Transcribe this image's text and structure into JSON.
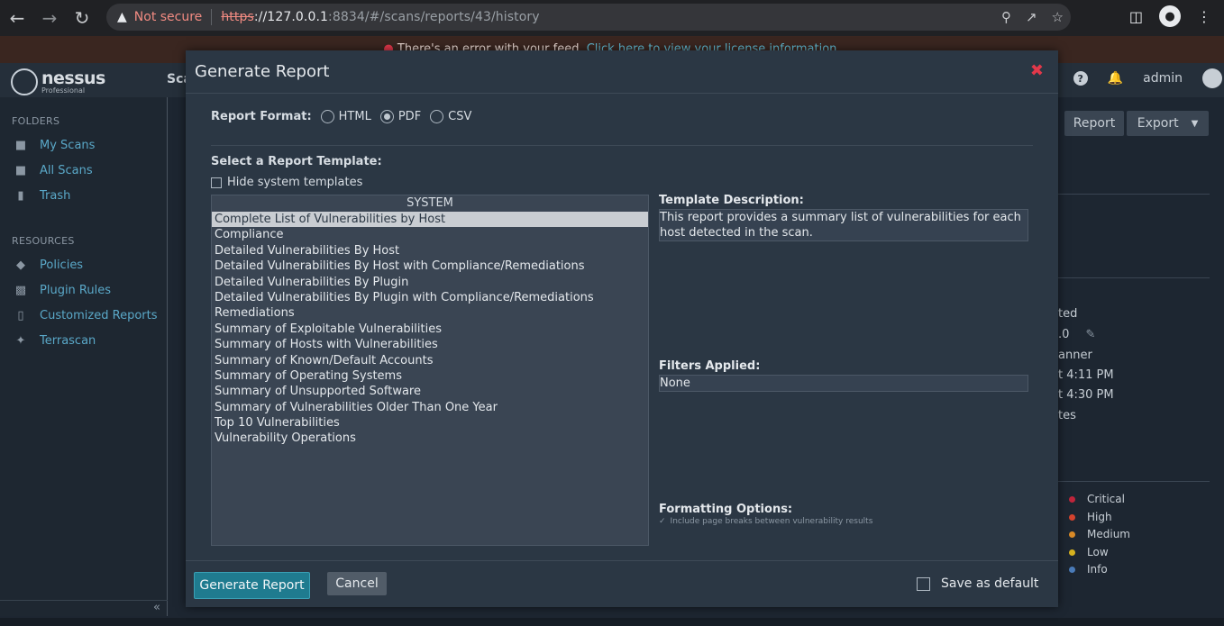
{
  "browser": {
    "warning_icon": "warning-triangle-icon",
    "not_secure": "Not secure",
    "url_scheme": "https",
    "url_host": "://127.0.0.1",
    "url_path": ":8834/#/scans/reports/43/history"
  },
  "banner": {
    "text": "There's an error with your feed. ",
    "link": "Click here to view your license information."
  },
  "header": {
    "logo_name": "nessus",
    "logo_sub": "Professional",
    "nav_scans": "Sca",
    "user": "admin"
  },
  "sidebar": {
    "folders_title": "FOLDERS",
    "folders": [
      {
        "label": "My Scans",
        "icon": "folder-icon"
      },
      {
        "label": "All Scans",
        "icon": "folder-icon"
      },
      {
        "label": "Trash",
        "icon": "trash-icon"
      }
    ],
    "resources_title": "RESOURCES",
    "resources": [
      {
        "label": "Policies",
        "icon": "shield-icon"
      },
      {
        "label": "Plugin Rules",
        "icon": "plugin-icon"
      },
      {
        "label": "Customized Reports",
        "icon": "document-icon"
      },
      {
        "label": "Terrascan",
        "icon": "terrascan-icon"
      }
    ],
    "collapse": "«"
  },
  "background": {
    "report_btn": "Report",
    "export_btn": "Export",
    "details": [
      "ted",
      ".0",
      "anner",
      "t 4:11 PM",
      "t 4:30 PM",
      "tes"
    ],
    "legend": [
      {
        "label": "Critical",
        "color": "#c0253b"
      },
      {
        "label": "High",
        "color": "#d4432e"
      },
      {
        "label": "Medium",
        "color": "#d98a27"
      },
      {
        "label": "Low",
        "color": "#d6b21f"
      },
      {
        "label": "Info",
        "color": "#4a7bb8"
      }
    ]
  },
  "modal": {
    "title": "Generate Report",
    "format_label": "Report Format:",
    "formats": [
      "HTML",
      "PDF",
      "CSV"
    ],
    "selected_format": "PDF",
    "template_title": "Select a Report Template:",
    "hide_system": "Hide system templates",
    "list_header": "SYSTEM",
    "templates": [
      "Complete List of Vulnerabilities by Host",
      "Compliance",
      "Detailed Vulnerabilities By Host",
      "Detailed Vulnerabilities By Host with Compliance/Remediations",
      "Detailed Vulnerabilities By Plugin",
      "Detailed Vulnerabilities By Plugin with Compliance/Remediations",
      "Remediations",
      "Summary of Exploitable Vulnerabilities",
      "Summary of Hosts with Vulnerabilities",
      "Summary of Known/Default Accounts",
      "Summary of Operating Systems",
      "Summary of Unsupported Software",
      "Summary of Vulnerabilities Older Than One Year",
      "Top 10 Vulnerabilities",
      "Vulnerability Operations"
    ],
    "selected_template": "Complete List of Vulnerabilities by Host",
    "desc_label": "Template Description:",
    "desc_text": "This report provides a summary list of vulnerabilities for each host detected in the scan.",
    "filters_label": "Filters Applied:",
    "filters_value": "None",
    "formatting_label": "Formatting Options:",
    "formatting_option": "Include page breaks between vulnerability results",
    "generate_btn": "Generate Report",
    "cancel_btn": "Cancel",
    "save_default": "Save as default"
  }
}
